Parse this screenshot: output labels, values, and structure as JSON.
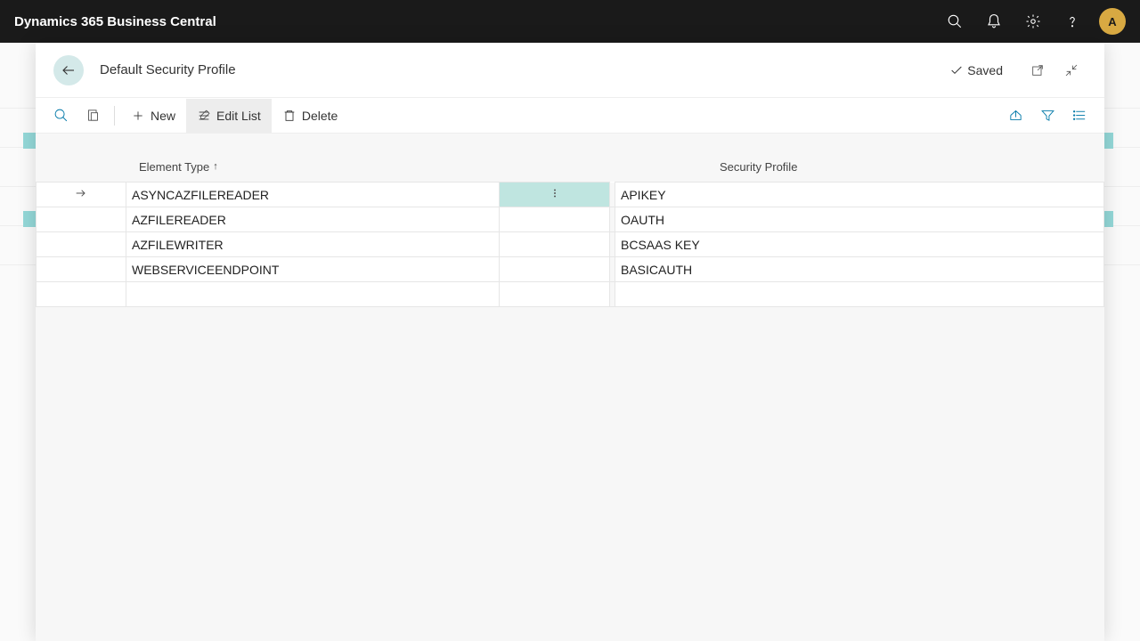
{
  "topbar": {
    "product": "Dynamics 365 Business Central",
    "avatar_initial": "A"
  },
  "modal": {
    "title": "Default Security Profile",
    "status": "Saved"
  },
  "toolbar": {
    "new_label": "New",
    "edit_list_label": "Edit List",
    "delete_label": "Delete"
  },
  "columns": {
    "element_type": "Element Type",
    "element_type_sort": "↑",
    "security_profile": "Security Profile"
  },
  "rows": [
    {
      "element_type": "ASYNCAZFILEREADER",
      "security_profile": "APIKEY",
      "selected": true
    },
    {
      "element_type": "AZFILEREADER",
      "security_profile": "OAUTH",
      "selected": false
    },
    {
      "element_type": "AZFILEWRITER",
      "security_profile": "BCSAAS KEY",
      "selected": false
    },
    {
      "element_type": "WEBSERVICEENDPOINT",
      "security_profile": "BASICAUTH",
      "selected": false
    }
  ]
}
